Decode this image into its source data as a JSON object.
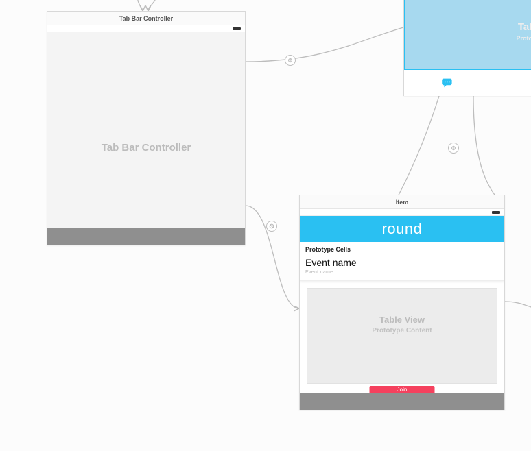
{
  "scene_tabbar": {
    "title": "Tab Bar Controller",
    "placeholder": "Tab Bar Controller"
  },
  "scene_item": {
    "title": "Item",
    "brand": "round",
    "proto_label": "Prototype Cells",
    "cell_title": "Event name",
    "cell_sub": "Event name",
    "tv_label": "Table View",
    "tv_sub": "Prototype Content",
    "action_label": "Join"
  },
  "scene_partial": {
    "tv_label": "Table View",
    "pc_label": "Prototype Content"
  }
}
